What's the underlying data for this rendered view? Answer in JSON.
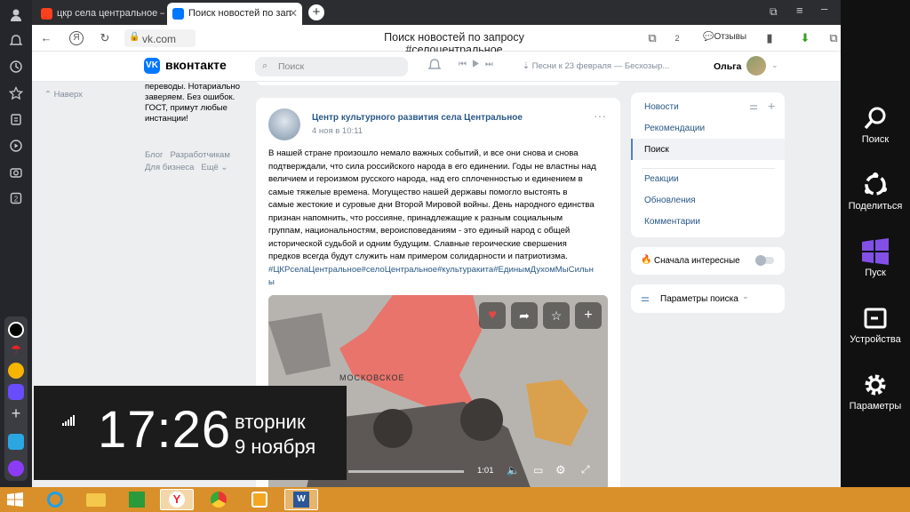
{
  "browser": {
    "tabs": [
      {
        "label": "цкр села центральное —"
      },
      {
        "label": "Поиск новостей по зап"
      }
    ],
    "url": "vk.com",
    "page_title": "Поиск новостей по запросу #селоцентральное",
    "feedback_label": "Отзывы",
    "tab_count": "2"
  },
  "vk": {
    "logo": "вконтакте",
    "search_placeholder": "Поиск",
    "player_track": "Песни к 23 февраля — Бесхозыр...",
    "user_name": "Ольга"
  },
  "leftcol": {
    "top_link": "Наверх",
    "ad_text": [
      "переводы. Нотариально",
      "заверяем. Без ошибок.",
      "ГОСТ, примут любые",
      "инстанции!"
    ],
    "footer": [
      "Блог",
      "Разработчикам",
      "Для бизнеса",
      "Ещё"
    ]
  },
  "post": {
    "author": "Центр культурного развития села Центральное",
    "date": "4 ноя в 10:11",
    "text_lines": [
      "В нашей стране произошло немало важных событий, и все они снова и снова",
      "подтверждали, что сила российского народа в его единении. Годы не властны над",
      "величием и героизмом русского народа, над его сплоченностью и единением в",
      "самые тяжелые времена. Могущество нашей державы помогло выстоять в",
      "самые жестокие и суровые дни Второй Мировой войны. День народного единства",
      "признан напомнить, что россияне, принадлежащие к разным социальным",
      "группам, национальностям, вероисповеданиям - это единый народ с общей",
      "исторической судьбой и одним будущим. Славные героические свершения",
      "предков всегда будут служить нам примером солидарности и патриотизма."
    ],
    "hashtags": [
      "#ЦКРселаЦентральное#селоЦентральное#культуракита#ЕдинымДухомМыСильн",
      "ы"
    ],
    "map_label": "МОСКОВСКОЕ",
    "video_time": "1:01"
  },
  "rightnav": {
    "group1": [
      "Новости",
      "Рекомендации",
      "Поиск"
    ],
    "group2": [
      "Реакции",
      "Обновления",
      "Комментарии"
    ],
    "interesting": "Сначала интересные",
    "search_params": "Параметры поиска"
  },
  "charms": [
    {
      "label": "Поиск",
      "icon": "search-icon"
    },
    {
      "label": "Поделиться",
      "icon": "share-icon"
    },
    {
      "label": "Пуск",
      "icon": "windows-icon"
    },
    {
      "label": "Устройства",
      "icon": "devices-icon"
    },
    {
      "label": "Параметры",
      "icon": "gear-icon"
    }
  ],
  "clock": {
    "time": "17:26",
    "weekday": "вторник",
    "date": "9 ноября"
  },
  "colors": {
    "vk_blue": "#0077ff",
    "taskbar": "#d9902a",
    "charms_bg": "#111111"
  }
}
